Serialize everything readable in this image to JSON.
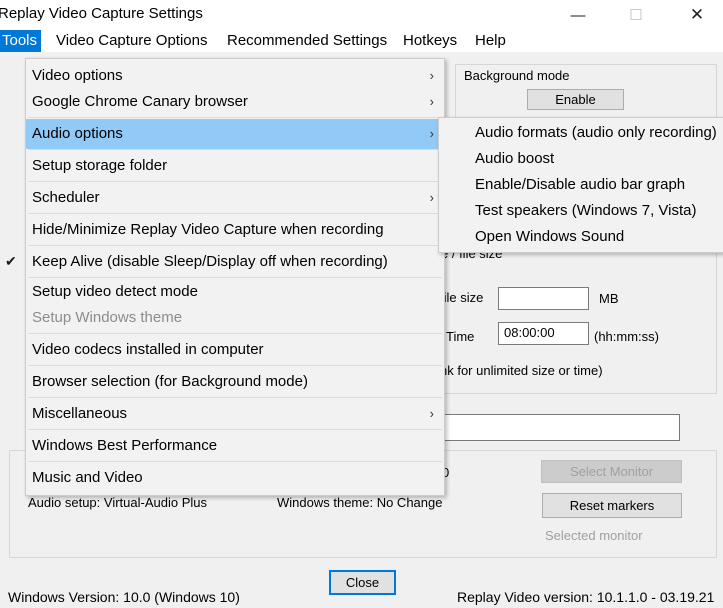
{
  "window": {
    "title": "Replay Video Capture Settings",
    "minimize_glyph": "—",
    "maximize_glyph": "☐",
    "close_glyph": "✕"
  },
  "menubar": {
    "items": [
      "Tools",
      "Video Capture Options",
      "Recommended Settings",
      "Hotkeys",
      "Help"
    ],
    "active": "Tools"
  },
  "tools_menu": {
    "items": [
      {
        "label": "Video options",
        "has_submenu": true,
        "checked": false,
        "disabled": false,
        "highlighted": false
      },
      {
        "label": "Google Chrome Canary browser",
        "has_submenu": true,
        "checked": false,
        "disabled": false,
        "highlighted": false
      },
      {
        "label": "Audio options",
        "has_submenu": true,
        "checked": false,
        "disabled": false,
        "highlighted": true
      },
      {
        "label": "Setup storage folder",
        "has_submenu": false,
        "checked": false,
        "disabled": false,
        "highlighted": false
      },
      {
        "label": "Scheduler",
        "has_submenu": true,
        "checked": false,
        "disabled": false,
        "highlighted": false
      },
      {
        "label": "Hide/Minimize Replay Video Capture when recording",
        "has_submenu": false,
        "checked": false,
        "disabled": false,
        "highlighted": false
      },
      {
        "label": "Keep Alive (disable Sleep/Display off when recording)",
        "has_submenu": false,
        "checked": true,
        "disabled": false,
        "highlighted": false
      },
      {
        "label": "Setup video detect mode",
        "has_submenu": false,
        "checked": false,
        "disabled": false,
        "highlighted": false
      },
      {
        "label": "Setup Windows theme",
        "has_submenu": false,
        "checked": false,
        "disabled": true,
        "highlighted": false
      },
      {
        "label": "Video codecs installed in computer",
        "has_submenu": false,
        "checked": false,
        "disabled": false,
        "highlighted": false
      },
      {
        "label": "Browser selection (for Background mode)",
        "has_submenu": false,
        "checked": false,
        "disabled": false,
        "highlighted": false
      },
      {
        "label": "Miscellaneous",
        "has_submenu": true,
        "checked": false,
        "disabled": false,
        "highlighted": false
      },
      {
        "label": "Windows Best Performance",
        "has_submenu": false,
        "checked": false,
        "disabled": false,
        "highlighted": false
      },
      {
        "label": "Music and Video",
        "has_submenu": false,
        "checked": false,
        "disabled": false,
        "highlighted": false
      }
    ],
    "submenu_arrow": "›",
    "check_glyph": "✔"
  },
  "audio_submenu": {
    "items": [
      "Audio formats (audio only recording)",
      "Audio boost",
      "Enable/Disable audio bar graph",
      "Test speakers (Windows 7, Vista)",
      "Open Windows Sound"
    ]
  },
  "dialog": {
    "background_mode_label": "Background mode",
    "enable_button": "Enable",
    "file_size_header_partial": "e / file size",
    "file_size_label_partial": "file size",
    "file_size_value": "",
    "file_size_unit": "MB",
    "time_label": "Time",
    "time_value": "08:00:00",
    "time_unit": "(hh:mm:ss)",
    "unlimited_note_partial": "nk for unlimited size or time)",
    "partial_digit": "0",
    "select_monitor_button": "Select Monitor",
    "reset_markers_button": "Reset markers",
    "selected_monitor_label": "Selected monitor",
    "audio_setup": "Audio setup: Virtual-Audio Plus",
    "windows_theme": "Windows theme: No Change",
    "close_button": "Close",
    "windows_version": "Windows Version: 10.0 (Windows 10)",
    "replay_version": "Replay Video version: 10.1.1.0 - 03.19.21"
  },
  "colors": {
    "menu_active": "#0078d7",
    "menu_highlight": "#91c9f7",
    "dialog_bg": "#f0f0f0"
  }
}
